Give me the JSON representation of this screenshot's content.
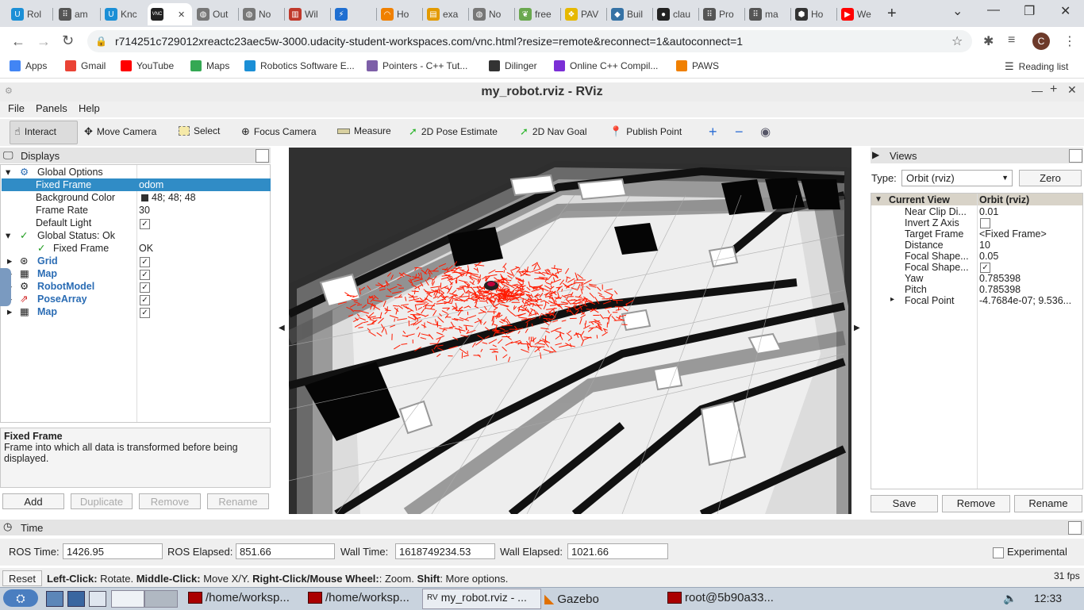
{
  "browser": {
    "tabs": [
      {
        "label": "Rol",
        "icon_color": "#1b8fd6",
        "glyph": "U"
      },
      {
        "label": "am",
        "icon_color": "#555555",
        "glyph": "⠿"
      },
      {
        "label": "Knc",
        "icon_color": "#1b8fd6",
        "glyph": "U"
      },
      {
        "label": "",
        "icon_color": "#222222",
        "glyph": "VNC",
        "active": true
      },
      {
        "label": "Out",
        "icon_color": "#777777",
        "glyph": "◍"
      },
      {
        "label": "No",
        "icon_color": "#777777",
        "glyph": "◍"
      },
      {
        "label": "Wil",
        "icon_color": "#c0392b",
        "glyph": "▥"
      },
      {
        "label": "",
        "icon_color": "#1f6fd1",
        "glyph": "⚡"
      },
      {
        "label": "Ho",
        "icon_color": "#f08000",
        "glyph": "◠"
      },
      {
        "label": "exa",
        "icon_color": "#e39a00",
        "glyph": "▤"
      },
      {
        "label": "No",
        "icon_color": "#777777",
        "glyph": "◍"
      },
      {
        "label": "free",
        "icon_color": "#6aa84f",
        "glyph": "❦"
      },
      {
        "label": "PAV",
        "icon_color": "#e6b800",
        "glyph": "❖"
      },
      {
        "label": "Buil",
        "icon_color": "#3572a5",
        "glyph": "◆"
      },
      {
        "label": "clau",
        "icon_color": "#222222",
        "glyph": "●"
      },
      {
        "label": "Pro",
        "icon_color": "#555555",
        "glyph": "⠿"
      },
      {
        "label": "ma",
        "icon_color": "#555555",
        "glyph": "⠿"
      },
      {
        "label": "Ho",
        "icon_color": "#333333",
        "glyph": "⬢"
      },
      {
        "label": "We",
        "icon_color": "#ff0000",
        "glyph": "▶"
      }
    ],
    "url": "r714251c729012xreactc23aec5w-3000.udacity-student-workspaces.com/vnc.html?resize=remote&reconnect=1&autoconnect=1",
    "profile_initial": "C",
    "bookmarks": [
      {
        "label": "Apps",
        "color": "#4285f4"
      },
      {
        "label": "Gmail",
        "color": "#ea4335"
      },
      {
        "label": "YouTube",
        "color": "#ff0000"
      },
      {
        "label": "Maps",
        "color": "#34a853"
      },
      {
        "label": "Robotics Software E...",
        "color": "#1b8fd6"
      },
      {
        "label": "Pointers - C++ Tut...",
        "color": "#7d5fa8"
      },
      {
        "label": "Dilinger",
        "color": "#333333"
      },
      {
        "label": "Online C++ Compil...",
        "color": "#7b2fd6"
      },
      {
        "label": "PAWS",
        "color": "#f08000"
      }
    ],
    "reading_list": "Reading list"
  },
  "rviz": {
    "window_title": "my_robot.rviz - RViz",
    "menu": [
      "File",
      "Panels",
      "Help"
    ],
    "tools": [
      {
        "label": "Interact",
        "icon": "hand-icon"
      },
      {
        "label": "Move Camera",
        "icon": "move-icon"
      },
      {
        "label": "Select",
        "icon": "select-icon"
      },
      {
        "label": "Focus Camera",
        "icon": "target-icon"
      },
      {
        "label": "Measure",
        "icon": "ruler-icon"
      },
      {
        "label": "2D Pose Estimate",
        "icon": "arrow-green-icon"
      },
      {
        "label": "2D Nav Goal",
        "icon": "arrow-green-icon"
      },
      {
        "label": "Publish Point",
        "icon": "pin-icon"
      }
    ],
    "displays": {
      "title": "Displays",
      "global_options": "Global Options",
      "fixed_frame_label": "Fixed Frame",
      "fixed_frame_value": "odom",
      "bg_color_label": "Background Color",
      "bg_color_value": "48; 48; 48",
      "frame_rate_label": "Frame Rate",
      "frame_rate_value": "30",
      "default_light_label": "Default Light",
      "global_status": "Global Status: Ok",
      "status_fixed_frame": "Fixed Frame",
      "status_ok": "OK",
      "items": [
        "Grid",
        "Map",
        "RobotModel",
        "PoseArray",
        "Map"
      ],
      "desc_title": "Fixed Frame",
      "desc_text": "Frame into which all data is transformed before being displayed.",
      "buttons": [
        "Add",
        "Duplicate",
        "Remove",
        "Rename"
      ]
    },
    "views": {
      "title": "Views",
      "type_label": "Type:",
      "type_value": "Orbit (rviz)",
      "zero": "Zero",
      "current_view": "Current View",
      "current_view_value": "Orbit (rviz)",
      "props": [
        {
          "k": "Near Clip Di...",
          "v": "0.01"
        },
        {
          "k": "Invert Z Axis",
          "v": ""
        },
        {
          "k": "Target Frame",
          "v": "<Fixed Frame>"
        },
        {
          "k": "Distance",
          "v": "10"
        },
        {
          "k": "Focal Shape...",
          "v": "0.05"
        },
        {
          "k": "Focal Shape...",
          "v": ""
        },
        {
          "k": "Yaw",
          "v": "0.785398"
        },
        {
          "k": "Pitch",
          "v": "0.785398"
        },
        {
          "k": "Focal Point",
          "v": "-4.7684e-07; 9.536..."
        }
      ],
      "buttons": [
        "Save",
        "Remove",
        "Rename"
      ]
    },
    "time": {
      "title": "Time",
      "ros_time_label": "ROS Time:",
      "ros_time": "1426.95",
      "ros_elapsed_label": "ROS Elapsed:",
      "ros_elapsed": "851.66",
      "wall_time_label": "Wall Time:",
      "wall_time": "1618749234.53",
      "wall_elapsed_label": "Wall Elapsed:",
      "wall_elapsed": "1021.66",
      "experimental": "Experimental"
    },
    "status": {
      "reset": "Reset",
      "left": "Left-Click:",
      "left_t": " Rotate. ",
      "middle": "Middle-Click:",
      "middle_t": " Move X/Y. ",
      "right": "Right-Click/Mouse Wheel:",
      "right_t": ": Zoom. ",
      "shift": "Shift",
      "shift_t": ": More options.",
      "fps": "31 fps"
    }
  },
  "taskbar": {
    "tasks": [
      "/home/worksp...",
      "/home/worksp...",
      "my_robot.rviz - ...",
      "Gazebo",
      "root@5b90a33..."
    ],
    "clock": "12:33"
  },
  "colors": {
    "particles": "#ff1a00",
    "accent": "#308cc6"
  }
}
